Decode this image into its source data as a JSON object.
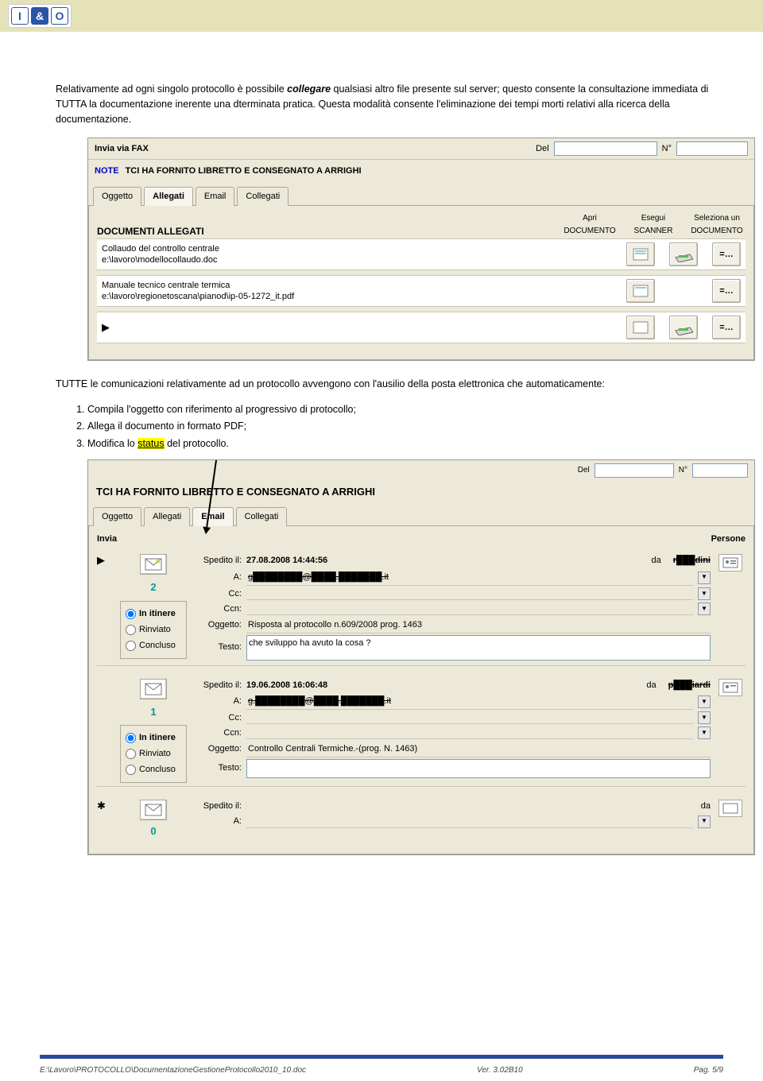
{
  "logo": {
    "i": "I",
    "amp": "&",
    "o": "O"
  },
  "para1_pre": "Relativamente ad ogni singolo protocollo è possibile ",
  "para1_ci": "collegare",
  "para1_post": " qualsiasi altro file presente sul server; questo consente la consultazione immediata di TUTTA la documentazione inerente una dterminata pratica. Questa modalità consente l'eliminazione dei tempi morti relativi alla ricerca della documentazione.",
  "shot1": {
    "fragment": "Invia via FAX",
    "del": "Del",
    "num": "N°",
    "note_label": "NOTE",
    "note_text": "TCI HA FORNITO LIBRETTO E CONSEGNATO A ARRIGHI",
    "tabs": [
      "Oggetto",
      "Allegati",
      "Email",
      "Collegati"
    ],
    "active_tab": 1,
    "section": "DOCUMENTI ALLEGATI",
    "col_a": "Apri DOCUMENTO",
    "col_b": "Esegui SCANNER",
    "col_c": "Seleziona un DOCUMENTO",
    "rows": [
      {
        "title": "Collaudo del controllo centrale",
        "path": "e:\\lavoro\\modellocollaudo.doc",
        "has_scan": true
      },
      {
        "title": "Manuale tecnico centrale termica",
        "path": "e:\\lavoro\\regionetoscana\\pianod\\ip-05-1272_it.pdf",
        "has_scan": false
      },
      {
        "title": "",
        "path": "",
        "has_scan": true,
        "blank": true
      }
    ]
  },
  "para2": {
    "intro": "TUTTE le comunicazioni relativamente ad un protocollo avvengono con l'ausilio della posta elettronica che automaticamente:",
    "li1": "Compila l'oggetto con riferimento al progressivo di protocollo;",
    "li2": "Allega il documento in formato PDF;",
    "li3_pre": "Modifica lo ",
    "li3_u": "status",
    "li3_post": " del protocollo."
  },
  "shot2": {
    "del": "Del",
    "num": "N°",
    "title": "TCI HA FORNITO LIBRETTO E CONSEGNATO A ARRIGHI",
    "tabs": [
      "Oggetto",
      "Allegati",
      "Email",
      "Collegati"
    ],
    "active_tab": 2,
    "invia": "Invia",
    "persone": "Persone",
    "radio": {
      "r1": "In itinere",
      "r2": "Rinviato",
      "r3": "Concluso"
    },
    "emails": [
      {
        "num": "2",
        "spedito_lbl": "Spedito il:",
        "spedito": "27.08.2008 14:44:56",
        "da_lbl": "da",
        "da": "r███dini",
        "a_lbl": "A:",
        "a": "g████████@████.███████.it",
        "cc_lbl": "Cc:",
        "cc": "",
        "ccn_lbl": "Ccn:",
        "ccn": "",
        "ogg_lbl": "Oggetto:",
        "ogg": "Risposta al protocollo n.609/2008 prog. 1463",
        "testo_lbl": "Testo:",
        "testo": "che sviluppo ha avuto la cosa ?"
      },
      {
        "num": "1",
        "spedito_lbl": "Spedito il:",
        "spedito": "19.06.2008 16:06:48",
        "da_lbl": "da",
        "da": "p███iardi",
        "a_lbl": "A:",
        "a": "g.████████@████.███████.it",
        "cc_lbl": "Cc:",
        "cc": "",
        "ccn_lbl": "Ccn:",
        "ccn": "",
        "ogg_lbl": "Oggetto:",
        "ogg": "Controllo Centrali Termiche.-(prog. N. 1463)",
        "testo_lbl": "Testo:",
        "testo": ""
      },
      {
        "num": "0",
        "spedito_lbl": "Spedito il:",
        "spedito": "",
        "da_lbl": "da",
        "da": "",
        "a_lbl": "A:",
        "a": "",
        "blank": true
      }
    ]
  },
  "footer": {
    "path": "E:\\Lavoro\\PROTOCOLLO\\DocumentazioneGestioneProtocollo2010_10.doc",
    "ver": "Ver. 3.02B10",
    "page": "Pag. 5/9"
  }
}
